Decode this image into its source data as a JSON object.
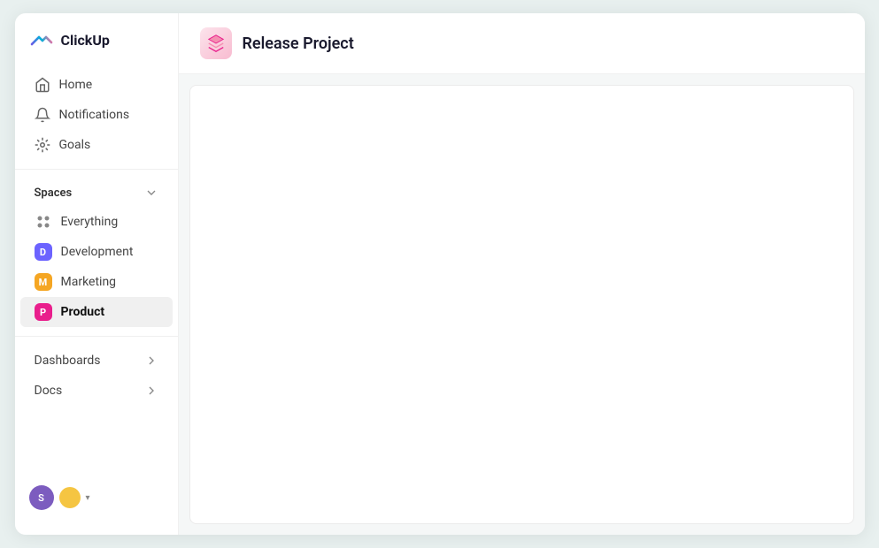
{
  "logo": {
    "text": "ClickUp"
  },
  "nav": {
    "home_label": "Home",
    "notifications_label": "Notifications",
    "goals_label": "Goals"
  },
  "spaces": {
    "section_label": "Spaces",
    "items": [
      {
        "id": "everything",
        "label": "Everything",
        "type": "dots",
        "active": false
      },
      {
        "id": "development",
        "label": "Development",
        "type": "badge",
        "badge_letter": "D",
        "badge_color": "#6c63ff",
        "active": false
      },
      {
        "id": "marketing",
        "label": "Marketing",
        "type": "badge",
        "badge_letter": "M",
        "badge_color": "#f5a623",
        "active": false
      },
      {
        "id": "product",
        "label": "Product",
        "type": "badge",
        "badge_letter": "P",
        "badge_color": "#e91e8c",
        "active": true
      }
    ]
  },
  "collapsibles": [
    {
      "id": "dashboards",
      "label": "Dashboards"
    },
    {
      "id": "docs",
      "label": "Docs"
    }
  ],
  "header": {
    "project_title": "Release Project"
  },
  "bottom": {
    "avatar_initials": "S"
  }
}
